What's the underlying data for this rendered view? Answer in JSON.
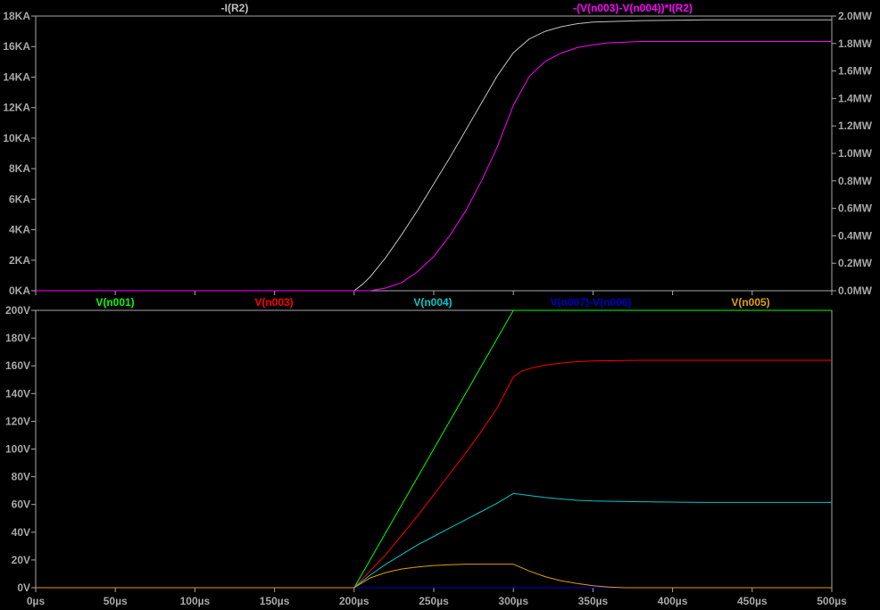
{
  "chart_data": [
    {
      "type": "line",
      "x_unit": "µs",
      "xlim": [
        0,
        500
      ],
      "xticks": [
        "0µs",
        "50µs",
        "100µs",
        "150µs",
        "200µs",
        "250µs",
        "300µs",
        "350µs",
        "400µs",
        "450µs",
        "500µs"
      ],
      "left_axis": {
        "ylim": [
          0,
          18
        ],
        "unit": "KA",
        "ticks": [
          "0KA",
          "2KA",
          "4KA",
          "6KA",
          "8KA",
          "10KA",
          "12KA",
          "14KA",
          "16KA",
          "18KA"
        ]
      },
      "right_axis": {
        "ylim": [
          0,
          2.0
        ],
        "unit": "MW",
        "ticks": [
          "0.0MW",
          "0.2MW",
          "0.4MW",
          "0.6MW",
          "0.8MW",
          "1.0MW",
          "1.2MW",
          "1.4MW",
          "1.6MW",
          "1.8MW",
          "2.0MW"
        ]
      },
      "series": [
        {
          "name": "-I(R2)",
          "axis": "left",
          "color": "#c0c0c0",
          "x": [
            0,
            200,
            205,
            210,
            220,
            230,
            240,
            250,
            260,
            270,
            280,
            290,
            300,
            310,
            320,
            330,
            340,
            350,
            380,
            420,
            460,
            500
          ],
          "y": [
            0,
            0,
            0.4,
            0.9,
            2.2,
            3.7,
            5.3,
            7.0,
            8.7,
            10.5,
            12.3,
            14.1,
            15.6,
            16.5,
            17.0,
            17.3,
            17.5,
            17.6,
            17.7,
            17.75,
            17.75,
            17.75
          ]
        },
        {
          "name": "-(V(n003)-V(n004))*I(R2)",
          "axis": "right",
          "color": "#ff00ff",
          "x": [
            0,
            210,
            220,
            230,
            240,
            250,
            260,
            270,
            280,
            290,
            300,
            310,
            320,
            330,
            340,
            350,
            360,
            370,
            380,
            400,
            450,
            500
          ],
          "y": [
            0,
            0,
            0.02,
            0.06,
            0.14,
            0.25,
            0.4,
            0.58,
            0.8,
            1.05,
            1.35,
            1.56,
            1.67,
            1.73,
            1.77,
            1.79,
            1.805,
            1.81,
            1.815,
            1.815,
            1.815,
            1.815
          ]
        }
      ]
    },
    {
      "type": "line",
      "x_unit": "µs",
      "xlim": [
        0,
        500
      ],
      "xticks": [
        "0µs",
        "50µs",
        "100µs",
        "150µs",
        "200µs",
        "250µs",
        "300µs",
        "350µs",
        "400µs",
        "450µs",
        "500µs"
      ],
      "ylim": [
        0,
        200
      ],
      "yticks": [
        "0V",
        "20V",
        "40V",
        "60V",
        "80V",
        "100V",
        "120V",
        "140V",
        "160V",
        "180V",
        "200V"
      ],
      "series": [
        {
          "name": "V(n001)",
          "color": "#00ff00",
          "x": [
            0,
            200,
            300,
            500
          ],
          "y": [
            0,
            0,
            200,
            200
          ]
        },
        {
          "name": "V(n003)",
          "color": "#ff0000",
          "x": [
            0,
            200,
            210,
            220,
            230,
            240,
            250,
            260,
            270,
            280,
            290,
            300,
            305,
            310,
            320,
            330,
            340,
            350,
            380,
            420,
            500
          ],
          "y": [
            0,
            0,
            12,
            24,
            38,
            52,
            67,
            82,
            97,
            113,
            130,
            152,
            156,
            158,
            160.5,
            162,
            163,
            163.5,
            164,
            164,
            164
          ]
        },
        {
          "name": "V(n004)",
          "color": "#00c8c8",
          "x": [
            0,
            200,
            210,
            220,
            230,
            240,
            250,
            260,
            270,
            280,
            290,
            300,
            310,
            320,
            330,
            340,
            350,
            380,
            420,
            500
          ],
          "y": [
            0,
            0,
            9,
            17,
            24,
            31,
            37,
            43,
            49,
            55,
            61,
            68,
            66.5,
            65,
            64,
            63,
            62.5,
            62,
            61.5,
            61.5
          ]
        },
        {
          "name": "V(n007)-V(n006)",
          "color": "#0000cc",
          "x": [
            0,
            500
          ],
          "y": [
            0,
            0
          ]
        },
        {
          "name": "V(n005)",
          "color": "#e0a000",
          "x": [
            0,
            200,
            210,
            220,
            230,
            240,
            250,
            260,
            270,
            280,
            290,
            300,
            310,
            320,
            330,
            340,
            350,
            360,
            370,
            500
          ],
          "y": [
            0,
            0,
            7,
            11,
            13.5,
            15,
            16,
            16.5,
            17,
            17,
            17,
            17,
            12,
            8,
            5,
            3,
            1.5,
            0.5,
            0,
            0
          ]
        }
      ]
    }
  ],
  "colors": {
    "background": "#000000",
    "frame": "#a8a8a8",
    "tick_text": "#a8a8a8"
  }
}
